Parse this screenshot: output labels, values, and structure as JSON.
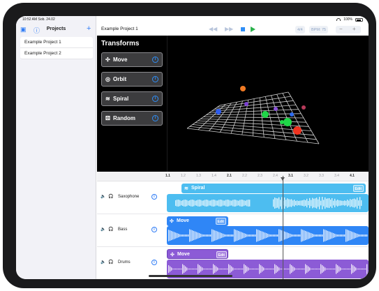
{
  "status_bar": {
    "time": "10:52 AM",
    "date": "Sob. 24.02",
    "battery": "100%"
  },
  "sidebar": {
    "title": "Projects",
    "add_icon": "plus-icon",
    "toggle_icon": "sidebar-toggle-icon",
    "help_icon": "question-icon",
    "projects": [
      "Example Project 1",
      "Example Project 2"
    ]
  },
  "toolbar": {
    "project_title": "Example Project 1",
    "time_signature": "4/4",
    "bpm": "BPM: 75",
    "minus": "−",
    "plus": "+",
    "rewind_icon": "rewind-icon",
    "forward_icon": "forward-icon",
    "stop_icon": "stop-icon",
    "play_icon": "play-icon"
  },
  "transforms": {
    "title": "Transforms",
    "items": [
      {
        "label": "Move",
        "icon": "move-icon"
      },
      {
        "label": "Orbit",
        "icon": "orbit-icon"
      },
      {
        "label": "Spiral",
        "icon": "spiral-icon"
      },
      {
        "label": "Random",
        "icon": "random-icon"
      }
    ],
    "info_glyph": "i"
  },
  "ruler": {
    "ticks": [
      "1.1",
      "1.2",
      "1.3",
      "1.4",
      "2.1",
      "2.2",
      "2.3",
      "2.4",
      "3.1",
      "3.2",
      "3.3",
      "3.4",
      "4.1"
    ],
    "major": [
      "1.1",
      "2.1",
      "3.1",
      "4.1"
    ]
  },
  "tracks": [
    {
      "name": "Saxophone",
      "clip_label": "Spiral",
      "clip_edit": "Edit",
      "color": "#4dbdf0"
    },
    {
      "name": "Bass",
      "clip_label": "Move",
      "clip_edit": "Edit",
      "color": "#2f86f6"
    },
    {
      "name": "Drums",
      "clip_label": "Move",
      "clip_edit": "Edit",
      "color": "#8c5bd6"
    }
  ],
  "colors": {
    "accent": "#2f7cf6",
    "play": "#2bb24c",
    "saxophone": "#4dbdf0",
    "bass": "#2f86f6",
    "drums": "#8c5bd6"
  }
}
